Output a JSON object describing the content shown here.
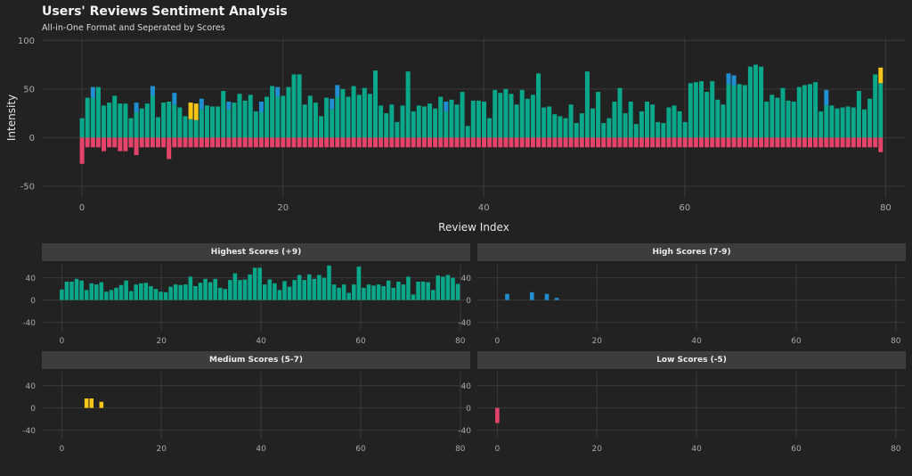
{
  "header": {
    "title": "Users' Reviews Sentiment Analysis",
    "subtitle": "All-in-One Format and Seperated by Scores"
  },
  "colors": {
    "highest": "#0aa88a",
    "high": "#1f8fd1",
    "medium": "#f5c518",
    "low": "#e5436a",
    "background": "#222222",
    "strip": "#3d3d3d"
  },
  "chart_data": [
    {
      "id": "main",
      "type": "bar",
      "stacked": true,
      "title": "Users' Reviews Sentiment Analysis",
      "subtitle": "All-in-One Format and Seperated by Scores",
      "xlabel": "Review Index",
      "ylabel": "Intensity",
      "xlim": [
        -4,
        82
      ],
      "ylim": [
        -62,
        103
      ],
      "xticks": [
        0,
        20,
        40,
        60,
        80
      ],
      "yticks": [
        -50,
        0,
        50,
        100
      ],
      "grid": true,
      "series": [
        {
          "key": "highest",
          "values": [
            20,
            41,
            41,
            52,
            33,
            36,
            43,
            35,
            35,
            20,
            26,
            30,
            35,
            43,
            21,
            36,
            37,
            34,
            31,
            22,
            19,
            18,
            29,
            33,
            32,
            32,
            48,
            29,
            36,
            45,
            38,
            44,
            27,
            26,
            42,
            53,
            42,
            43,
            52,
            65,
            65,
            34,
            43,
            36,
            22,
            41,
            29,
            42,
            50,
            42,
            53,
            44,
            51,
            45,
            69,
            33,
            25,
            34,
            16,
            33,
            68,
            27,
            33,
            32,
            35,
            30,
            42,
            27,
            39,
            34,
            47,
            12,
            38,
            38,
            37,
            20,
            49,
            46,
            50,
            45,
            34,
            49,
            40,
            44,
            66,
            31,
            32,
            24,
            22,
            20,
            34,
            15,
            25,
            68,
            30,
            47,
            15,
            20,
            37,
            51,
            25,
            37,
            14,
            27,
            37,
            34,
            16,
            15,
            31,
            33,
            27,
            16,
            56,
            57,
            58,
            47,
            58,
            39,
            34,
            55,
            53,
            55,
            54,
            73,
            75,
            73,
            37,
            44,
            41,
            51,
            38,
            37,
            52,
            54,
            55,
            57,
            27,
            33,
            33,
            30,
            31,
            32,
            31,
            48,
            29,
            40,
            65,
            56
          ]
        },
        {
          "key": "high",
          "values": [
            0,
            0,
            11,
            0,
            0,
            0,
            0,
            0,
            0,
            0,
            10,
            0,
            0,
            10,
            0,
            0,
            0,
            12,
            0,
            0,
            0,
            0,
            11,
            0,
            0,
            0,
            0,
            8,
            0,
            0,
            0,
            0,
            0,
            11,
            0,
            0,
            10,
            0,
            0,
            0,
            0,
            0,
            0,
            0,
            0,
            0,
            11,
            12,
            0,
            0,
            0,
            0,
            0,
            0,
            0,
            0,
            0,
            0,
            0,
            0,
            0,
            0,
            0,
            0,
            0,
            0,
            0,
            10,
            0,
            0,
            0,
            0,
            0,
            0,
            0,
            0,
            0,
            0,
            0,
            0,
            0,
            0,
            0,
            0,
            0,
            0,
            0,
            0,
            0,
            0,
            0,
            0,
            0,
            0,
            0,
            0,
            0,
            0,
            0,
            0,
            0,
            0,
            0,
            0,
            0,
            0,
            0,
            0,
            0,
            0,
            0,
            0,
            0,
            0,
            0,
            0,
            0,
            0,
            0,
            11,
            11,
            0,
            0,
            0,
            0,
            0,
            0,
            0,
            0,
            0,
            0,
            0,
            0,
            0,
            0,
            0,
            0,
            16,
            0,
            0,
            0,
            0,
            0,
            0,
            0,
            0,
            0,
            0
          ]
        },
        {
          "key": "medium",
          "values": [
            0,
            0,
            0,
            0,
            0,
            0,
            0,
            0,
            0,
            0,
            0,
            0,
            0,
            0,
            0,
            0,
            0,
            0,
            0,
            0,
            17,
            17,
            0,
            0,
            0,
            0,
            0,
            0,
            0,
            0,
            0,
            0,
            0,
            0,
            0,
            0,
            0,
            0,
            0,
            0,
            0,
            0,
            0,
            0,
            0,
            0,
            0,
            0,
            0,
            0,
            0,
            0,
            0,
            0,
            0,
            0,
            0,
            0,
            0,
            0,
            0,
            0,
            0,
            0,
            0,
            0,
            0,
            0,
            0,
            0,
            0,
            0,
            0,
            0,
            0,
            0,
            0,
            0,
            0,
            0,
            0,
            0,
            0,
            0,
            0,
            0,
            0,
            0,
            0,
            0,
            0,
            0,
            0,
            0,
            0,
            0,
            0,
            0,
            0,
            0,
            0,
            0,
            0,
            0,
            0,
            0,
            0,
            0,
            0,
            0,
            0,
            0,
            0,
            0,
            0,
            0,
            0,
            0,
            0,
            0,
            0,
            0,
            0,
            0,
            0,
            0,
            0,
            0,
            0,
            0,
            0,
            0,
            0,
            0,
            0,
            0,
            0,
            0,
            0,
            0,
            0,
            0,
            0,
            0,
            0,
            0,
            0,
            16
          ]
        },
        {
          "key": "low",
          "values": [
            -27,
            -10,
            -10,
            -10,
            -14,
            -10,
            -10,
            -14,
            -14,
            -10,
            -18,
            -10,
            -10,
            -10,
            -10,
            -10,
            -22,
            -10,
            -10,
            -10,
            -10,
            -10,
            -10,
            -10,
            -10,
            -10,
            -10,
            -10,
            -10,
            -10,
            -10,
            -10,
            -10,
            -10,
            -10,
            -10,
            -10,
            -10,
            -10,
            -10,
            -10,
            -10,
            -10,
            -10,
            -10,
            -10,
            -10,
            -10,
            -10,
            -10,
            -10,
            -10,
            -10,
            -10,
            -10,
            -10,
            -10,
            -10,
            -10,
            -10,
            -10,
            -10,
            -10,
            -10,
            -10,
            -10,
            -10,
            -10,
            -10,
            -10,
            -10,
            -10,
            -10,
            -10,
            -10,
            -10,
            -10,
            -10,
            -10,
            -10,
            -10,
            -10,
            -10,
            -10,
            -10,
            -10,
            -10,
            -10,
            -10,
            -10,
            -10,
            -10,
            -10,
            -10,
            -10,
            -10,
            -10,
            -10,
            -10,
            -10,
            -10,
            -10,
            -10,
            -10,
            -10,
            -10,
            -10,
            -10,
            -10,
            -10,
            -10,
            -10,
            -10,
            -10,
            -10,
            -10,
            -10,
            -10,
            -10,
            -10,
            -10,
            -10,
            -10,
            -10,
            -10,
            -10,
            -10,
            -10,
            -10,
            -10,
            -10,
            -10,
            -10,
            -10,
            -10,
            -10,
            -10,
            -10,
            -10,
            -10,
            -10,
            -10,
            -10,
            -10,
            -10,
            -10,
            -10,
            -15
          ]
        }
      ]
    },
    {
      "id": "highest",
      "type": "bar",
      "title": "Highest Scores (+9)",
      "xlim": [
        -4,
        82
      ],
      "ylim": [
        -55,
        65
      ],
      "xticks": [
        0,
        20,
        40,
        60,
        80
      ],
      "yticks": [
        -40,
        0,
        40
      ],
      "values": [
        19,
        33,
        33,
        38,
        35,
        18,
        30,
        28,
        32,
        15,
        18,
        22,
        27,
        35,
        16,
        28,
        30,
        31,
        25,
        20,
        15,
        14,
        24,
        28,
        27,
        28,
        42,
        25,
        31,
        38,
        32,
        38,
        22,
        20,
        36,
        48,
        36,
        37,
        46,
        58,
        58,
        28,
        37,
        30,
        18,
        34,
        24,
        36,
        45,
        36,
        46,
        38,
        45,
        40,
        62,
        28,
        22,
        28,
        13,
        28,
        60,
        22,
        28,
        26,
        28,
        25,
        35,
        22,
        33,
        28,
        42,
        10,
        33,
        33,
        32,
        18,
        44,
        42,
        45,
        40,
        29
      ]
    },
    {
      "id": "high",
      "type": "bar",
      "title": "High Scores (7-9)",
      "xlim": [
        -4,
        82
      ],
      "ylim": [
        -55,
        65
      ],
      "xticks": [
        0,
        20,
        40,
        60,
        80
      ],
      "yticks": [
        -40,
        0,
        40
      ],
      "values": [
        0,
        0,
        11,
        0,
        0,
        0,
        0,
        14,
        0,
        0,
        11,
        0,
        4,
        0,
        0,
        0,
        0,
        0,
        0,
        0,
        0,
        0,
        0,
        0,
        0,
        0,
        0,
        0,
        0,
        0,
        0,
        0,
        0,
        0,
        0,
        0,
        0,
        0,
        0,
        0,
        0,
        0,
        0,
        0,
        0,
        0,
        0,
        0,
        0,
        0,
        0,
        0,
        0,
        0,
        0,
        0,
        0,
        0,
        0,
        0,
        0,
        0,
        0,
        0,
        0,
        0,
        0,
        0,
        0,
        0,
        0,
        0,
        0,
        0,
        0,
        0,
        0,
        0,
        0,
        0,
        0
      ]
    },
    {
      "id": "medium",
      "type": "bar",
      "title": "Medium Scores (5-7)",
      "xlim": [
        -4,
        82
      ],
      "ylim": [
        -55,
        65
      ],
      "xticks": [
        0,
        20,
        40,
        60,
        80
      ],
      "yticks": [
        -40,
        0,
        40
      ],
      "values": [
        0,
        0,
        0,
        0,
        0,
        17,
        17,
        0,
        11,
        0,
        0,
        0,
        0,
        0,
        0,
        0,
        0,
        0,
        0,
        0,
        0,
        0,
        0,
        0,
        0,
        0,
        0,
        0,
        0,
        0,
        0,
        0,
        0,
        0,
        0,
        0,
        0,
        0,
        0,
        0,
        0,
        0,
        0,
        0,
        0,
        0,
        0,
        0,
        0,
        0,
        0,
        0,
        0,
        0,
        0,
        0,
        0,
        0,
        0,
        0,
        0,
        0,
        0,
        0,
        0,
        0,
        0,
        0,
        0,
        0,
        0,
        0,
        0,
        0,
        0,
        0,
        0,
        0,
        0,
        0,
        0
      ]
    },
    {
      "id": "low",
      "type": "bar",
      "title": "Low Scores (-5)",
      "xlim": [
        -4,
        82
      ],
      "ylim": [
        -55,
        65
      ],
      "xticks": [
        0,
        20,
        40,
        60,
        80
      ],
      "yticks": [
        -40,
        0,
        40
      ],
      "values": [
        -27,
        0,
        0,
        0,
        0,
        0,
        0,
        0,
        0,
        0,
        0,
        0,
        0,
        0,
        0,
        0,
        0,
        0,
        0,
        0,
        0,
        0,
        0,
        0,
        0,
        0,
        0,
        0,
        0,
        0,
        0,
        0,
        0,
        0,
        0,
        0,
        0,
        0,
        0,
        0,
        0,
        0,
        0,
        0,
        0,
        0,
        0,
        0,
        0,
        0,
        0,
        0,
        0,
        0,
        0,
        0,
        0,
        0,
        0,
        0,
        0,
        0,
        0,
        0,
        0,
        0,
        0,
        0,
        0,
        0,
        0,
        0,
        0,
        0,
        0,
        0,
        0,
        0,
        0,
        0,
        0
      ]
    }
  ]
}
